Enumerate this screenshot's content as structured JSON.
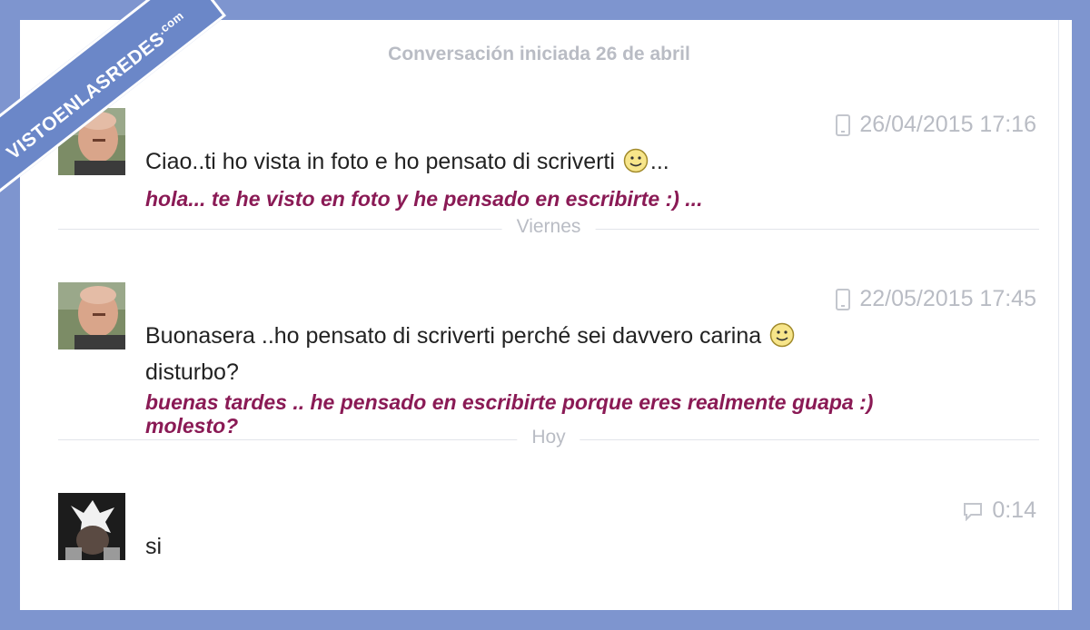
{
  "conversation": {
    "started": "Conversación iniciada 26 de abril"
  },
  "messages": [
    {
      "timestamp": "26/04/2015 17:16",
      "text_before": "Ciao..ti ho vista in foto e ho pensato di scriverti",
      "text_after": "...",
      "translation": "hola... te he visto en foto y he pensado en escribirte :) ...",
      "source_icon": "mobile-icon"
    },
    {
      "timestamp": "22/05/2015 17:45",
      "text_before": "Buonasera ..ho pensato di scriverti perché sei davvero carina",
      "line2": "disturbo?",
      "translation": "buenas tardes .. he pensado en escribirte porque eres realmente guapa :)",
      "translation_line2": "molesto?",
      "source_icon": "mobile-icon"
    },
    {
      "timestamp": "0:14",
      "text": "si",
      "source_icon": "chat-bubble-icon"
    }
  ],
  "separators": [
    "Viernes",
    "Hoy"
  ],
  "watermark": {
    "text": "VISTOENLASREDES",
    "suffix": ".com"
  },
  "colors": {
    "frame": "#7e95cf",
    "translation": "#8a1a55",
    "meta": "#b9bcc4"
  }
}
